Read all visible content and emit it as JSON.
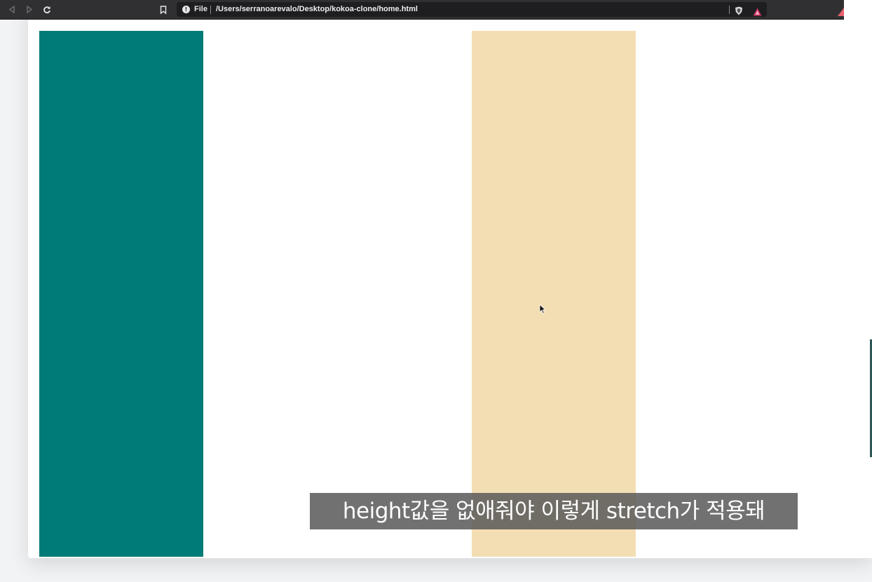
{
  "browser": {
    "scheme_label": "File",
    "url": "/Users/serranoarevalo/Desktop/kokoa-clone/home.html",
    "icons": {
      "back": "back-icon",
      "forward": "forward-icon",
      "reload": "reload-icon",
      "bookmark": "bookmark-icon",
      "info": "info-icon",
      "shield_extension": "shield-icon",
      "rewards_extension": "triangle-icon"
    }
  },
  "page": {
    "blocks": [
      {
        "name": "teal-block",
        "color": "#017b77"
      },
      {
        "name": "wheat-block",
        "color": "#f3deb3"
      }
    ]
  },
  "subtitle": {
    "text": "height값을 없애줘야 이렇게 stretch가 적용돼"
  }
}
